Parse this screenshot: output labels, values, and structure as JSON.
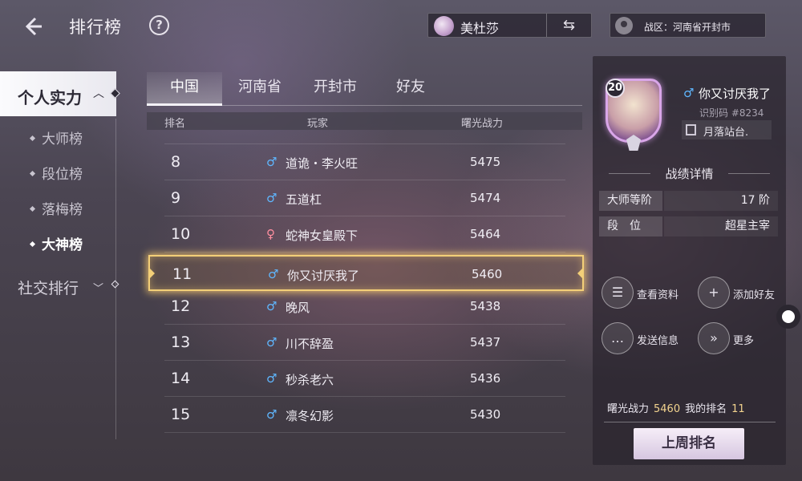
{
  "header": {
    "title": "排行榜",
    "help_icon": "?",
    "hero": {
      "name": "美杜莎",
      "avatar_icon": "hero-avatar-icon",
      "swap_icon": "⇆"
    },
    "region": {
      "label": "战区：河南省开封市",
      "icon": "location-pin-icon"
    }
  },
  "sidebar": {
    "categories": [
      {
        "label": "个人实力",
        "expanded": true,
        "items": [
          {
            "label": "大师榜",
            "active": false
          },
          {
            "label": "段位榜",
            "active": false
          },
          {
            "label": "落梅榜",
            "active": false
          },
          {
            "label": "大神榜",
            "active": true
          }
        ]
      },
      {
        "label": "社交排行",
        "expanded": false
      }
    ]
  },
  "tabs": [
    {
      "label": "中国",
      "active": true
    },
    {
      "label": "河南省",
      "active": false
    },
    {
      "label": "开封市",
      "active": false
    },
    {
      "label": "好友",
      "active": false
    }
  ],
  "table": {
    "columns": [
      "排名",
      "玩家",
      "曙光战力"
    ],
    "rows": [
      {
        "rank": "8",
        "gender": "♂",
        "gender_type": "male",
        "name": "道诡・李火旺",
        "power": "5475"
      },
      {
        "rank": "9",
        "gender": "♂",
        "gender_type": "male",
        "name": "五道杠",
        "power": "5474"
      },
      {
        "rank": "10",
        "gender": "♀",
        "gender_type": "female",
        "name": "蛇神女皇殿下",
        "power": "5464"
      },
      {
        "rank": "11",
        "gender": "♂",
        "gender_type": "male",
        "name": "你又讨厌我了",
        "power": "5460",
        "highlight": true
      },
      {
        "rank": "12",
        "gender": "♂",
        "gender_type": "male",
        "name": "晚风",
        "power": "5438"
      },
      {
        "rank": "13",
        "gender": "♂",
        "gender_type": "male",
        "name": "川不辞盈",
        "power": "5437"
      },
      {
        "rank": "14",
        "gender": "♂",
        "gender_type": "male",
        "name": "秒杀老六",
        "power": "5436"
      },
      {
        "rank": "15",
        "gender": "♂",
        "gender_type": "male",
        "name": "凛冬幻影",
        "power": "5430"
      }
    ]
  },
  "player_card": {
    "level": "20",
    "gender": "♂",
    "name": "你又讨厌我了",
    "id_text": "识别码 #8234",
    "guild": "月落站台.",
    "section_title": "战绩详情",
    "stats": [
      {
        "label": "大师等阶",
        "value": "17 阶"
      },
      {
        "label": "段　位",
        "value": "超星主宰"
      }
    ],
    "actions": [
      {
        "label": "查看资料",
        "icon": "profile-icon",
        "glyph": "☰"
      },
      {
        "label": "添加好友",
        "icon": "add-friend-icon",
        "glyph": "+"
      },
      {
        "label": "发送信息",
        "icon": "message-icon",
        "glyph": "…"
      },
      {
        "label": "更多",
        "icon": "more-icon",
        "glyph": "»"
      }
    ],
    "footer": {
      "power_label": "曙光战力",
      "power_value": "5460",
      "rank_label": "我的排名",
      "rank_value": "11"
    },
    "lastweek_button": "上周排名"
  },
  "colors": {
    "highlight_border": "#f3cf78",
    "male": "#5fb7ff",
    "female": "#ff8fa0",
    "accent_value": "#f3d48f"
  }
}
